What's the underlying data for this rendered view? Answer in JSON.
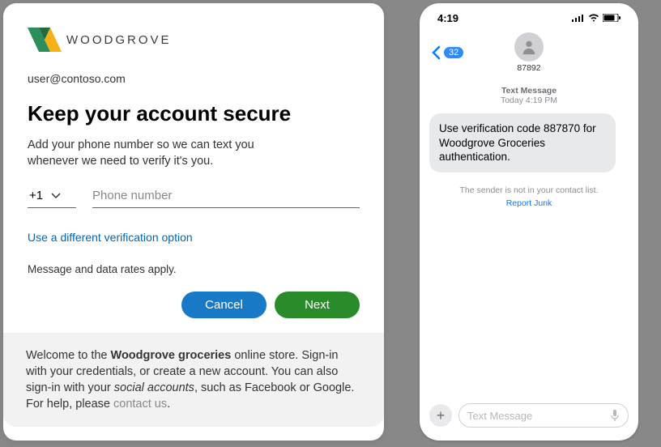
{
  "logo_text": "WOODGROVE",
  "email": "user@contoso.com",
  "title": "Keep your account secure",
  "description": "Add your phone number so we can text you whenever we need to verify it's you.",
  "country_code": "+1",
  "phone_placeholder": "Phone number",
  "alt_option": "Use a different verification option",
  "rates_notice": "Message and data rates apply.",
  "buttons": {
    "cancel": "Cancel",
    "next": "Next"
  },
  "welcome": {
    "pre": "Welcome to the ",
    "brand": "Woodgrove groceries",
    "mid1": " online store. Sign-in with your credentials, or create a new account. You can also sign-in with your ",
    "social": "social accounts",
    "mid2": ", such as Facebook or Google. For help, please ",
    "contact": "contact us",
    "end": "."
  },
  "phone_ui": {
    "time": "4:19",
    "back_badge": "32",
    "sender": "87892",
    "ts_label": "Text Message",
    "ts_time": "Today 4:19 PM",
    "bubble": "Use verification code 887870 for Woodgrove Groceries authentication.",
    "not_in_contacts": "The sender is not in your contact list.",
    "report_junk": "Report Junk",
    "compose_placeholder": "Text Message"
  }
}
